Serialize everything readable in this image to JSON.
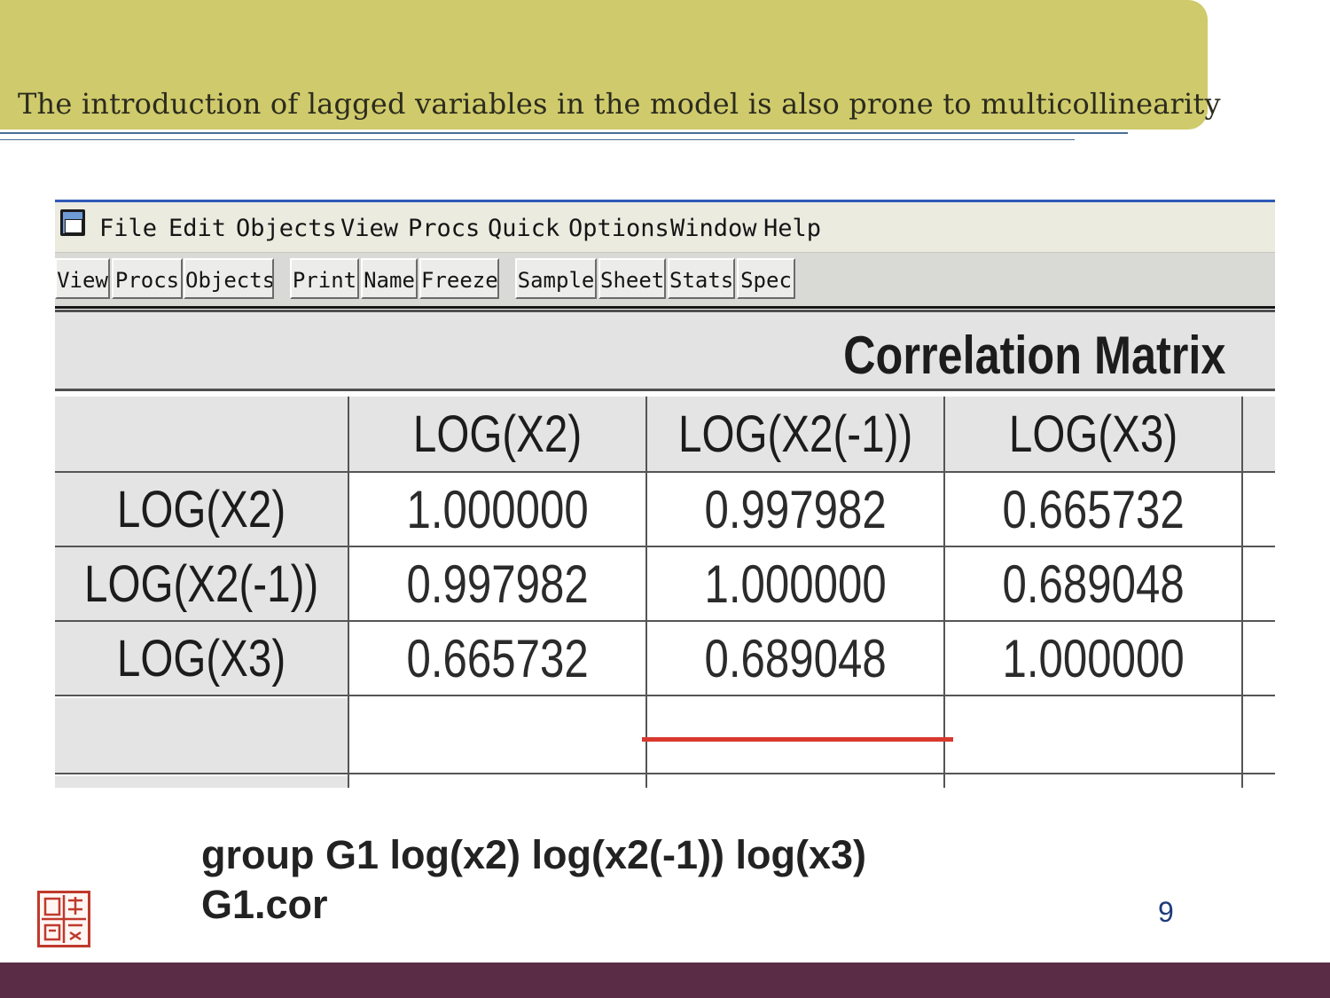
{
  "slide": {
    "title": "The introduction of lagged variables in the model is also prone to multicollinearity",
    "page_number": "9",
    "command_line_1": "group G1 log(x2) log(x2(-1)) log(x3)",
    "command_line_2": "G1.cor"
  },
  "menubar": {
    "items": [
      "File",
      "Edit",
      "Objects",
      "View",
      "Procs",
      "Quick",
      "Options",
      "Window",
      "Help"
    ]
  },
  "toolbar": {
    "buttons": [
      "View",
      "Procs",
      "Objects",
      "Print",
      "Name",
      "Freeze",
      "Sample",
      "Sheet",
      "Stats",
      "Spec"
    ]
  },
  "matrix": {
    "title": "Correlation Matrix",
    "columns": [
      "LOG(X2)",
      "LOG(X2(-1))",
      "LOG(X3)"
    ],
    "rows": [
      {
        "label": "LOG(X2)",
        "values": [
          "1.000000",
          "0.997982",
          "0.665732"
        ]
      },
      {
        "label": "LOG(X2(-1))",
        "values": [
          "0.997982",
          "1.000000",
          "0.689048"
        ]
      },
      {
        "label": "LOG(X3)",
        "values": [
          "0.665732",
          "0.689048",
          "1.000000"
        ]
      }
    ],
    "highlight": {
      "row": "LOG(X2)",
      "column": "LOG(X2(-1))",
      "value": "0.997982",
      "color": "#d9382e"
    }
  },
  "colors": {
    "title_band": "#cfca6b",
    "bottom_band": "#5b2c46",
    "accent_line": "#4a6f93"
  }
}
